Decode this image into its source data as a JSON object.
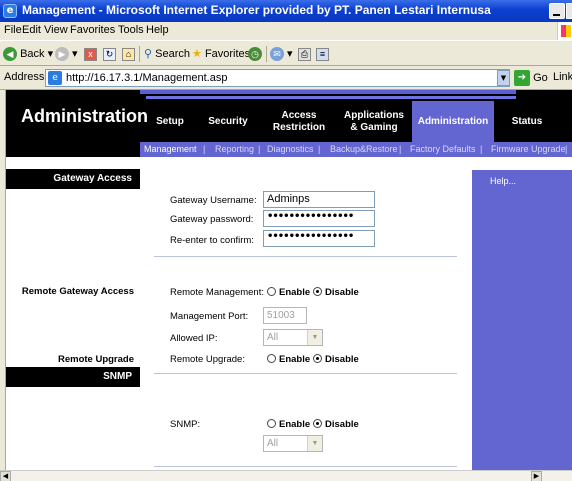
{
  "window": {
    "title": "Management - Microsoft Internet Explorer provided by PT. Panen Lestari Internusa"
  },
  "menu": [
    "File",
    "Edit",
    "View",
    "Favorites",
    "Tools",
    "Help"
  ],
  "toolbar": {
    "back": "Back",
    "search": "Search",
    "favorites": "Favorites"
  },
  "address": {
    "label": "Address",
    "url": "http://16.17.3.1/Management.asp",
    "go": "Go",
    "links": "Links"
  },
  "page": {
    "title": "Administration",
    "nav": [
      {
        "label": "Setup"
      },
      {
        "label": "Security"
      },
      {
        "label": "Access\nRestriction"
      },
      {
        "label": "Applications\n& Gaming"
      },
      {
        "label": "Administration"
      },
      {
        "label": "Status"
      }
    ],
    "subnav": [
      "Management",
      "|",
      "Reporting",
      "|",
      "Diagnostics",
      "|",
      "Backup&Restore",
      "|",
      "Factory Defaults",
      "|",
      "Firmware Upgrade",
      "|"
    ],
    "sections": {
      "gateway_access": "Gateway Access",
      "remote_gateway_access": "Remote Gateway Access",
      "remote_upgrade": "Remote Upgrade",
      "snmp": "SNMP"
    },
    "help": "Help...",
    "form": {
      "gateway_username_label": "Gateway Username:",
      "gateway_username_value": "Adminps",
      "gateway_password_label": "Gateway password:",
      "gateway_password_value": "••••••••••••••••",
      "reenter_label": "Re-enter to confirm:",
      "reenter_value": "••••••••••••••••",
      "remote_mgmt_label": "Remote Management:",
      "enable": "Enable",
      "disable": "Disable",
      "mgmt_port_label": "Management Port:",
      "mgmt_port_value": "51003",
      "allowed_ip_label": "Allowed IP:",
      "allowed_ip_value": "All",
      "remote_upgrade_label": "Remote Upgrade:",
      "snmp_label": "SNMP:",
      "snmp_select_value": "All"
    }
  }
}
